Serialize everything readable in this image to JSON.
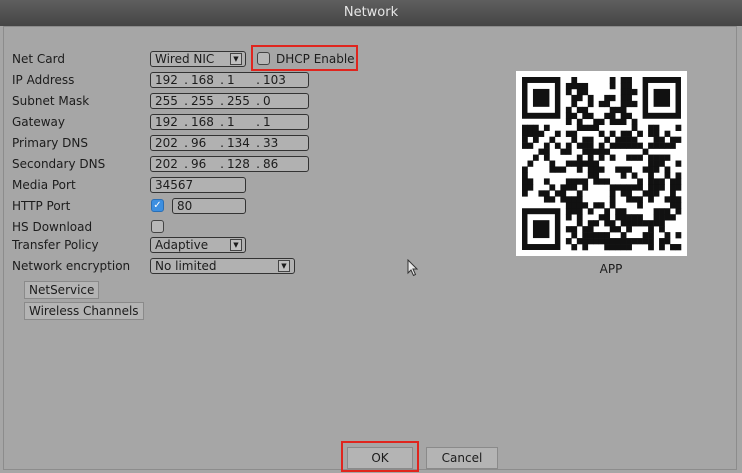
{
  "window": {
    "title": "Network"
  },
  "labels": {
    "net_card": "Net Card",
    "ip_address": "IP Address",
    "subnet_mask": "Subnet Mask",
    "gateway": "Gateway",
    "primary_dns": "Primary DNS",
    "secondary_dns": "Secondary DNS",
    "media_port": "Media Port",
    "http_port": "HTTP Port",
    "hs_download": "HS Download",
    "transfer_policy": "Transfer Policy",
    "network_encryption": "Network encryption"
  },
  "fields": {
    "net_card": "Wired NIC",
    "dhcp_label": "DHCP Enable",
    "dhcp_checked": false,
    "ip_address": [
      "192",
      "168",
      "1",
      "103"
    ],
    "subnet_mask": [
      "255",
      "255",
      "255",
      "0"
    ],
    "gateway": [
      "192",
      "168",
      "1",
      "1"
    ],
    "primary_dns": [
      "202",
      "96",
      "134",
      "33"
    ],
    "secondary_dns": [
      "202",
      "96",
      "128",
      "86"
    ],
    "media_port": "34567",
    "http_port_enabled": true,
    "http_port": "80",
    "hs_download_checked": false,
    "transfer_policy": "Adaptive",
    "network_encryption": "No limited"
  },
  "buttons": {
    "net_service": "NetService",
    "wireless_channels": "Wireless Channels",
    "ok": "OK",
    "cancel": "Cancel"
  },
  "qr": {
    "label": "APP"
  },
  "colors": {
    "highlight": "#e0251e",
    "checkbox_checked": "#3d8fe0",
    "titlebar": "#4f4f4f"
  }
}
